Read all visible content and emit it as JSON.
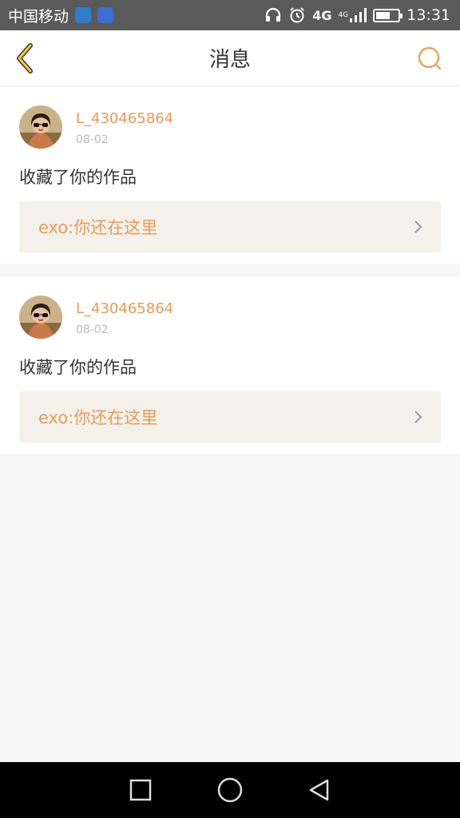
{
  "status_bar": {
    "carrier": "中国移动",
    "network": "4G",
    "network2": "4G",
    "time": "13:31",
    "battery_level": 0.55
  },
  "header": {
    "title": "消息",
    "back_icon": "chevron-left-icon",
    "search_icon": "search-icon",
    "accent_color": "#f0a25e"
  },
  "messages": [
    {
      "username": "L_430465864",
      "date": "08-02",
      "action": "收藏了你的作品",
      "work_title": "exo:你还在这里"
    },
    {
      "username": "L_430465864",
      "date": "08-02",
      "action": "收藏了你的作品",
      "work_title": "exo:你还在这里"
    }
  ],
  "nav": {
    "recents_icon": "square-icon",
    "home_icon": "circle-icon",
    "back_icon": "triangle-back-icon"
  }
}
